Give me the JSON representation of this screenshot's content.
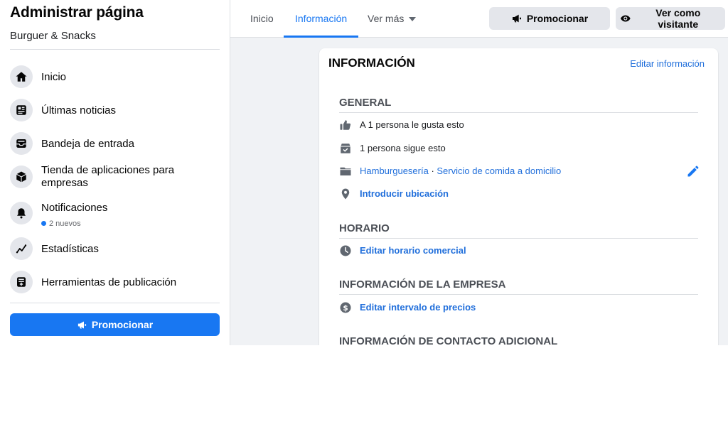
{
  "sidebar": {
    "title": "Administrar página",
    "page_name": "Burguer & Snacks",
    "items": [
      {
        "label": "Inicio",
        "icon": "home-icon"
      },
      {
        "label": "Últimas noticias",
        "icon": "news-icon"
      },
      {
        "label": "Bandeja de entrada",
        "icon": "inbox-icon"
      },
      {
        "label": "Tienda de aplicaciones para empresas",
        "icon": "box-icon"
      },
      {
        "label": "Notificaciones",
        "icon": "bell-icon",
        "meta": "2 nuevos"
      },
      {
        "label": "Estadísticas",
        "icon": "chart-icon"
      },
      {
        "label": "Herramientas de publicación",
        "icon": "tools-icon"
      }
    ],
    "promote_label": "Promocionar"
  },
  "topbar": {
    "tabs": [
      {
        "label": "Inicio"
      },
      {
        "label": "Información",
        "active": true
      },
      {
        "label": "Ver más"
      }
    ],
    "promote_label": "Promocionar",
    "view_as_label": "Ver como visitante"
  },
  "card": {
    "title": "INFORMACIÓN",
    "edit_link": "Editar información",
    "sections": [
      {
        "heading": "GENERAL",
        "rows": [
          {
            "icon": "like-icon",
            "text": "A 1 persona le gusta esto"
          },
          {
            "icon": "follow-icon",
            "text": "1 persona sigue esto"
          },
          {
            "icon": "folder-icon",
            "category_1": "Hamburguesería",
            "separator": " · ",
            "category_2": "Servicio de comida a domicilio"
          },
          {
            "icon": "location-pin-icon",
            "text": "Introducir ubicación"
          }
        ]
      },
      {
        "heading": "HORARIO",
        "rows": [
          {
            "icon": "clock-icon",
            "text": "Editar horario comercial"
          }
        ]
      },
      {
        "heading": "INFORMACIÓN DE LA EMPRESA",
        "rows": [
          {
            "icon": "dollar-icon",
            "text": "Editar intervalo de precios"
          }
        ]
      },
      {
        "heading": "INFORMACIÓN DE CONTACTO ADICIONAL"
      }
    ]
  },
  "colors": {
    "accent": "#1877f2",
    "link": "#216fdb",
    "background": "#f0f2f5",
    "button_gray": "#e4e6eb"
  }
}
